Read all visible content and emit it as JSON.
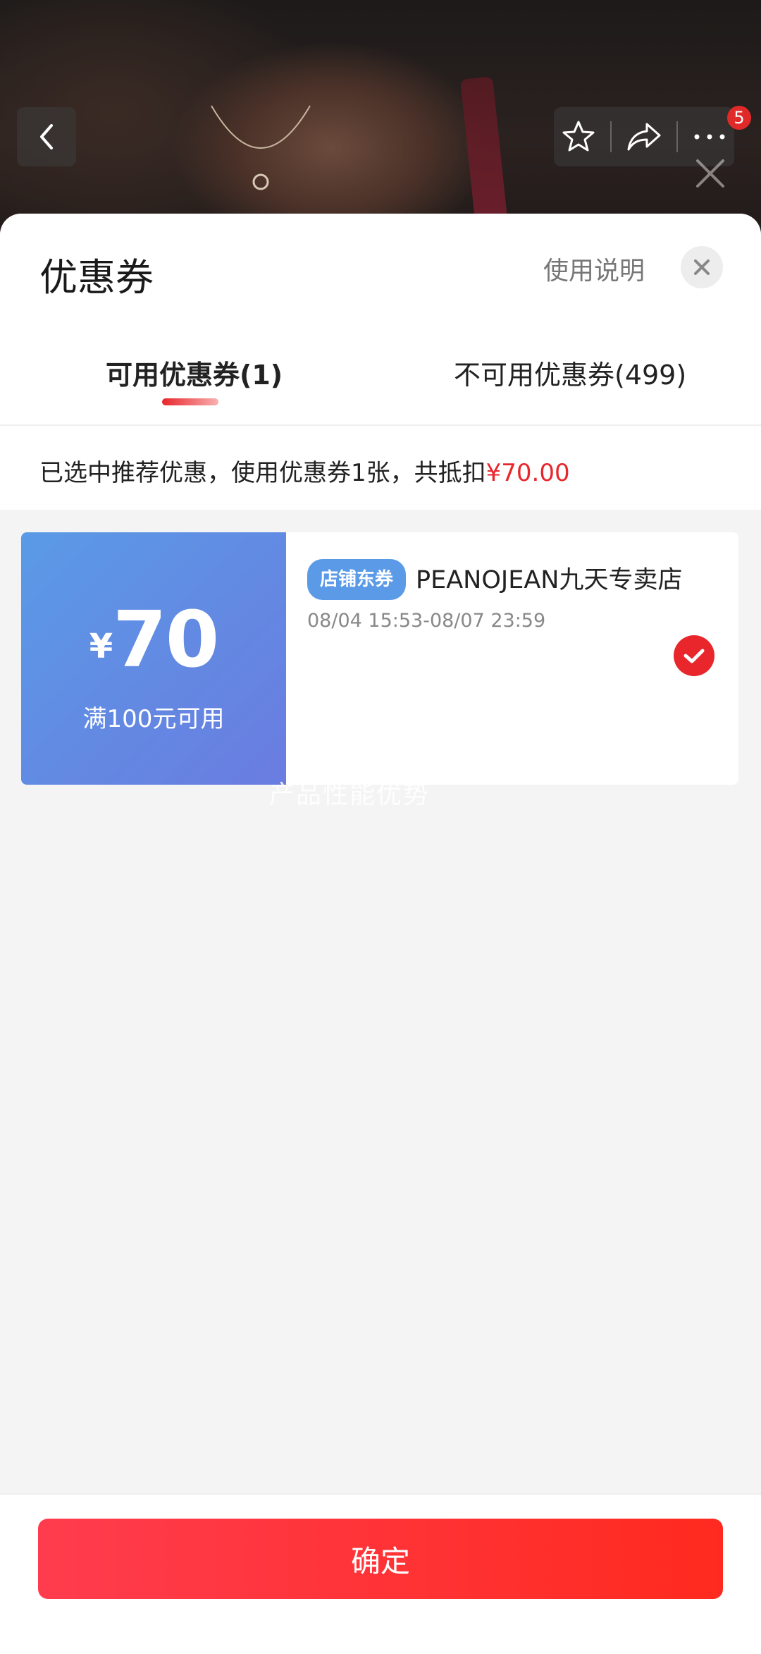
{
  "topbar": {
    "more_badge_count": "5",
    "icons": [
      "chevron-left-icon",
      "star-icon",
      "share-icon",
      "more-icon",
      "close-icon"
    ]
  },
  "sheet": {
    "title": "优惠券",
    "help_label": "使用说明",
    "tabs": [
      {
        "label": "可用优惠券(1)",
        "active": true
      },
      {
        "label": "不可用优惠券(499)",
        "active": false
      }
    ],
    "summary_prefix": "已选中推荐优惠，使用优惠券1张，共抵扣",
    "summary_amount": "¥70.00"
  },
  "coupons": [
    {
      "currency": "¥",
      "amount": "70",
      "condition": "满100元可用",
      "tag": "店铺东券",
      "shop_name": "PEANOJEAN九天专卖店",
      "validity": "08/04 15:53-08/07 23:59",
      "selected": true
    }
  ],
  "watermark": "产品性能优势",
  "footer": {
    "confirm_label": "确定"
  },
  "colors": {
    "accent": "#e8262c",
    "coupon_blue": "#5a9ae6"
  }
}
